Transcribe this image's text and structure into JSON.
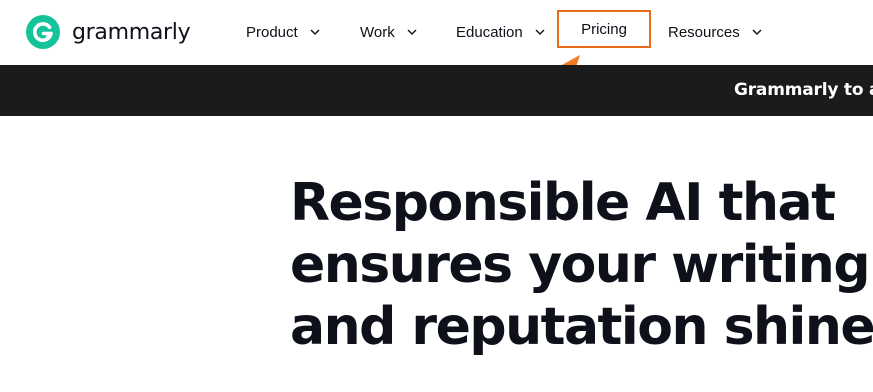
{
  "brand": {
    "name": "grammarly",
    "color": "#15c39a"
  },
  "nav": {
    "items": [
      {
        "label": "Product",
        "icon": "chevron-down-icon"
      },
      {
        "label": "Work",
        "icon": "chevron-down-icon"
      },
      {
        "label": "Education",
        "icon": "chevron-down-icon"
      },
      {
        "label": "Pricing"
      },
      {
        "label": "Resources",
        "icon": "chevron-down-icon"
      }
    ],
    "highlight_color": "#e86a1a"
  },
  "banner": {
    "text": "Grammarly to a"
  },
  "hero": {
    "lines": [
      "Responsible AI that",
      "ensures your writing",
      "and reputation shine"
    ]
  }
}
